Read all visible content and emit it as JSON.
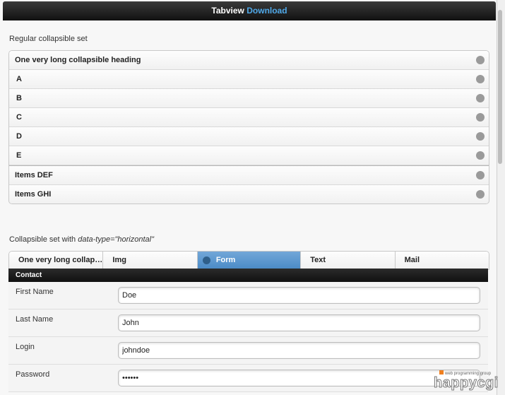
{
  "header": {
    "title": "Tabview",
    "link": "Download"
  },
  "regular": {
    "label": "Regular collapsible set",
    "items": [
      {
        "label": "One very long collapsible heading",
        "sub": false
      },
      {
        "label": "A",
        "sub": true
      },
      {
        "label": "B",
        "sub": true
      },
      {
        "label": "C",
        "sub": true
      },
      {
        "label": "D",
        "sub": true
      },
      {
        "label": "E",
        "sub": true
      },
      {
        "label": "Items DEF",
        "sub": false
      },
      {
        "label": "Items GHI",
        "sub": false
      }
    ]
  },
  "horizontal": {
    "label_prefix": "Collapsible set with ",
    "label_code": "data-type=\"horizontal\"",
    "tabs": [
      "One very long collapsible heading",
      "Img",
      "Form",
      "Text",
      "Mail"
    ],
    "active_tab": 2
  },
  "contact": {
    "title": "Contact",
    "fields": [
      {
        "label": "First Name",
        "value": "Doe",
        "type": "text"
      },
      {
        "label": "Last Name",
        "value": "John",
        "type": "text"
      },
      {
        "label": "Login",
        "value": "johndoe",
        "type": "text"
      },
      {
        "label": "Password",
        "value": "123456",
        "type": "password"
      }
    ]
  },
  "watermark": {
    "tagline": "web programming group",
    "brand": "happycgi"
  },
  "colors": {
    "accent": "#4a8ac6",
    "link": "#4fa8e8",
    "header": "#1a1a1a"
  }
}
